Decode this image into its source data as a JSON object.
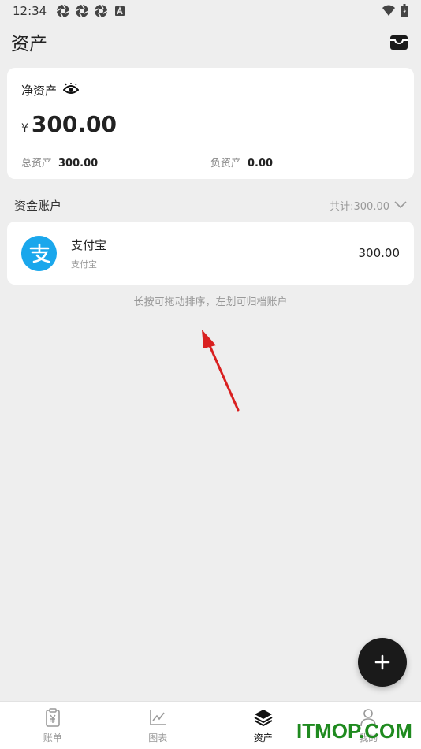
{
  "status_bar": {
    "time": "12:34"
  },
  "header": {
    "title": "资产",
    "action_icon": "archive-box-icon"
  },
  "net_assets": {
    "label": "净资产",
    "currency": "¥",
    "value": "300.00",
    "total_assets_label": "总资产",
    "total_assets_value": "300.00",
    "liabilities_label": "负资产",
    "liabilities_value": "0.00"
  },
  "funds_section": {
    "title": "资金账户",
    "total": "共计:300.00"
  },
  "accounts": [
    {
      "name": "支付宝",
      "subtitle": "支付宝",
      "balance": "300.00",
      "icon": "alipay-icon",
      "color": "#1aa7ec"
    }
  ],
  "hint": "长按可拖动排序，左划可归档账户",
  "bottom_nav": [
    {
      "label": "账单",
      "icon": "bill-icon",
      "active": false
    },
    {
      "label": "图表",
      "icon": "chart-icon",
      "active": false
    },
    {
      "label": "资产",
      "icon": "layers-icon",
      "active": true
    },
    {
      "label": "我的",
      "icon": "user-icon",
      "active": false
    }
  ],
  "watermark": "ITMOP.COM",
  "colors": {
    "accent": "#1aa7ec",
    "fab": "#1a1a1a",
    "arrow": "#d92020",
    "watermark": "#1f8a1f"
  }
}
